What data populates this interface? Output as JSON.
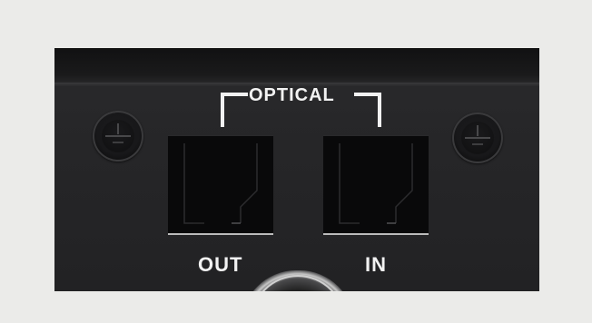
{
  "panel": {
    "group_label": "OPTICAL",
    "ports": [
      {
        "label": "OUT"
      },
      {
        "label": "IN"
      }
    ]
  },
  "colors": {
    "background": "#ebebe9",
    "panel": "#262628",
    "text": "#f2f2f2",
    "port": "#09090a"
  }
}
